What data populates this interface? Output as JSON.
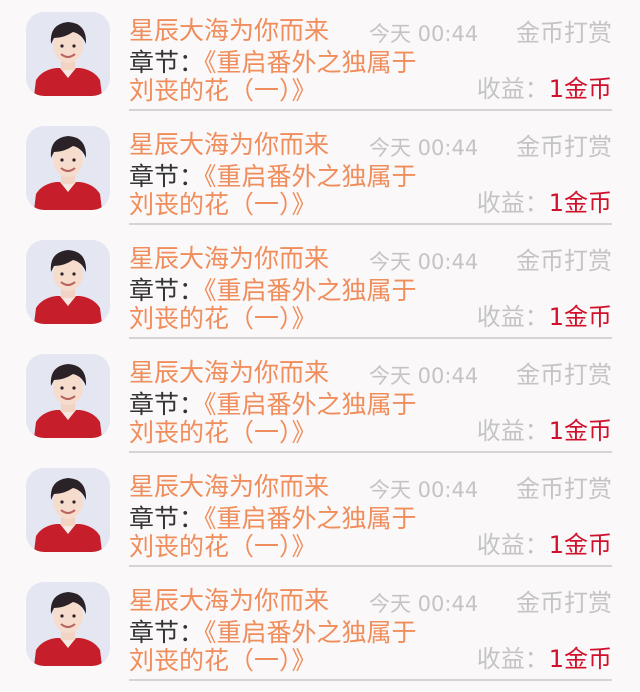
{
  "items": [
    {
      "username": "星辰大海为你而来",
      "time": "今天 00:44",
      "reward_label": "金币打赏",
      "chapter_label": "章节：",
      "chapter_title_line1": "《重启番外之独属于",
      "chapter_title_line2": "刘丧的花（一）》",
      "income_label": "收益：",
      "income_value": "1金币"
    },
    {
      "username": "星辰大海为你而来",
      "time": "今天 00:44",
      "reward_label": "金币打赏",
      "chapter_label": "章节：",
      "chapter_title_line1": "《重启番外之独属于",
      "chapter_title_line2": "刘丧的花（一）》",
      "income_label": "收益：",
      "income_value": "1金币"
    },
    {
      "username": "星辰大海为你而来",
      "time": "今天 00:44",
      "reward_label": "金币打赏",
      "chapter_label": "章节：",
      "chapter_title_line1": "《重启番外之独属于",
      "chapter_title_line2": "刘丧的花（一）》",
      "income_label": "收益：",
      "income_value": "1金币"
    },
    {
      "username": "星辰大海为你而来",
      "time": "今天 00:44",
      "reward_label": "金币打赏",
      "chapter_label": "章节：",
      "chapter_title_line1": "《重启番外之独属于",
      "chapter_title_line2": "刘丧的花（一）》",
      "income_label": "收益：",
      "income_value": "1金币"
    },
    {
      "username": "星辰大海为你而来",
      "time": "今天 00:44",
      "reward_label": "金币打赏",
      "chapter_label": "章节：",
      "chapter_title_line1": "《重启番外之独属于",
      "chapter_title_line2": "刘丧的花（一）》",
      "income_label": "收益：",
      "income_value": "1金币"
    },
    {
      "username": "星辰大海为你而来",
      "time": "今天 00:44",
      "reward_label": "金币打赏",
      "chapter_label": "章节：",
      "chapter_title_line1": "《重启番外之独属于",
      "chapter_title_line2": "刘丧的花（一）》",
      "income_label": "收益：",
      "income_value": "1金币"
    }
  ],
  "colors": {
    "background": "#fbf8f9",
    "username": "#ef8e5c",
    "muted": "#c4c4c4",
    "text": "#333333",
    "income": "#d0112b",
    "divider": "#d4d4d4"
  }
}
